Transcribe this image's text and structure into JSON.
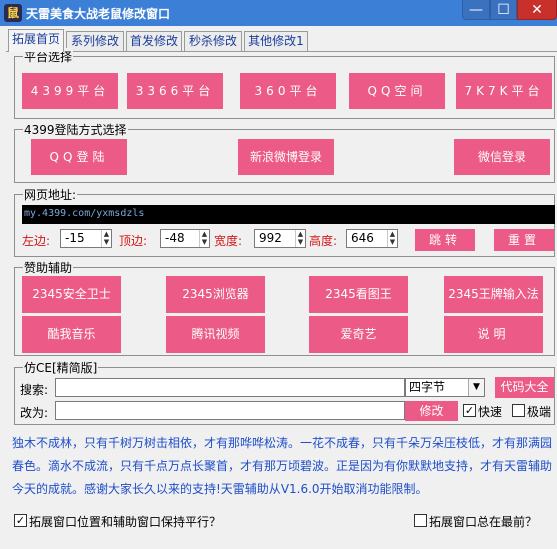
{
  "window": {
    "title": "天雷美食大战老鼠修改窗口",
    "minimize": "—",
    "maximize": "☐",
    "close": "✕"
  },
  "tabs": [
    {
      "label": "拓展首页",
      "active": true
    },
    {
      "label": "系列修改"
    },
    {
      "label": "首发修改"
    },
    {
      "label": "秒杀修改"
    },
    {
      "label": "其他修改1"
    }
  ],
  "platform": {
    "legend": "平台选择",
    "buttons": [
      "4399平台",
      "3366平台",
      "360平台",
      "QQ空间",
      "7K7K平台"
    ]
  },
  "login": {
    "legend": "4399登陆方式选择",
    "buttons": [
      "QQ登陆",
      "新浪微博登录",
      "微信登录"
    ]
  },
  "web": {
    "legend": "网页地址:",
    "url": "my.4399.com/yxmsdzls",
    "left_label": "左边:",
    "left_value": "-15",
    "top_label": "顶边:",
    "top_value": "-48",
    "width_label": "宽度:",
    "width_value": "992",
    "height_label": "高度:",
    "height_value": "646",
    "jump_label": "跳转",
    "reset_label": "重置"
  },
  "support": {
    "legend": "赞助辅助",
    "row1": [
      "2345安全卫士",
      "2345浏览器",
      "2345看图王",
      "2345王牌输入法"
    ],
    "row2": [
      "酷我音乐",
      "腾讯视频",
      "爱奇艺",
      "说明"
    ]
  },
  "ce": {
    "legend": "仿CE[精简版]",
    "search_label": "搜索:",
    "search_value": "",
    "type_value": "四字节",
    "codes_label": "代码大全",
    "change_label": "改为:",
    "change_value": "",
    "modify_label": "修改",
    "fast_label": "快速",
    "fast_checked": true,
    "extreme_label": "极端",
    "extreme_checked": false
  },
  "notice": {
    "text": "独木不成林，只有千树万树击相依，才有那哗哗松涛。一花不成春，只有千朵万朵压枝低，才有那满园春色。滴水不成流，只有千点万点长聚首，才有那万顷碧波。正是因为有你默默地支持，才有天雷辅助今天的成就。感谢大家长久以来的支持!天雷辅助从V1.6.0开始取消功能限制。"
  },
  "footer": {
    "sync_label": "拓展窗口位置和辅助窗口保持平行？",
    "sync_checked": true,
    "topmost_label": "拓展窗口总在最前？",
    "topmost_checked": false
  },
  "colors": {
    "button_pink": "#ec5a87",
    "titlebar_blue": "#3c7fd6",
    "notice_blue": "#1f4ec8",
    "label_red": "#d0181a"
  }
}
